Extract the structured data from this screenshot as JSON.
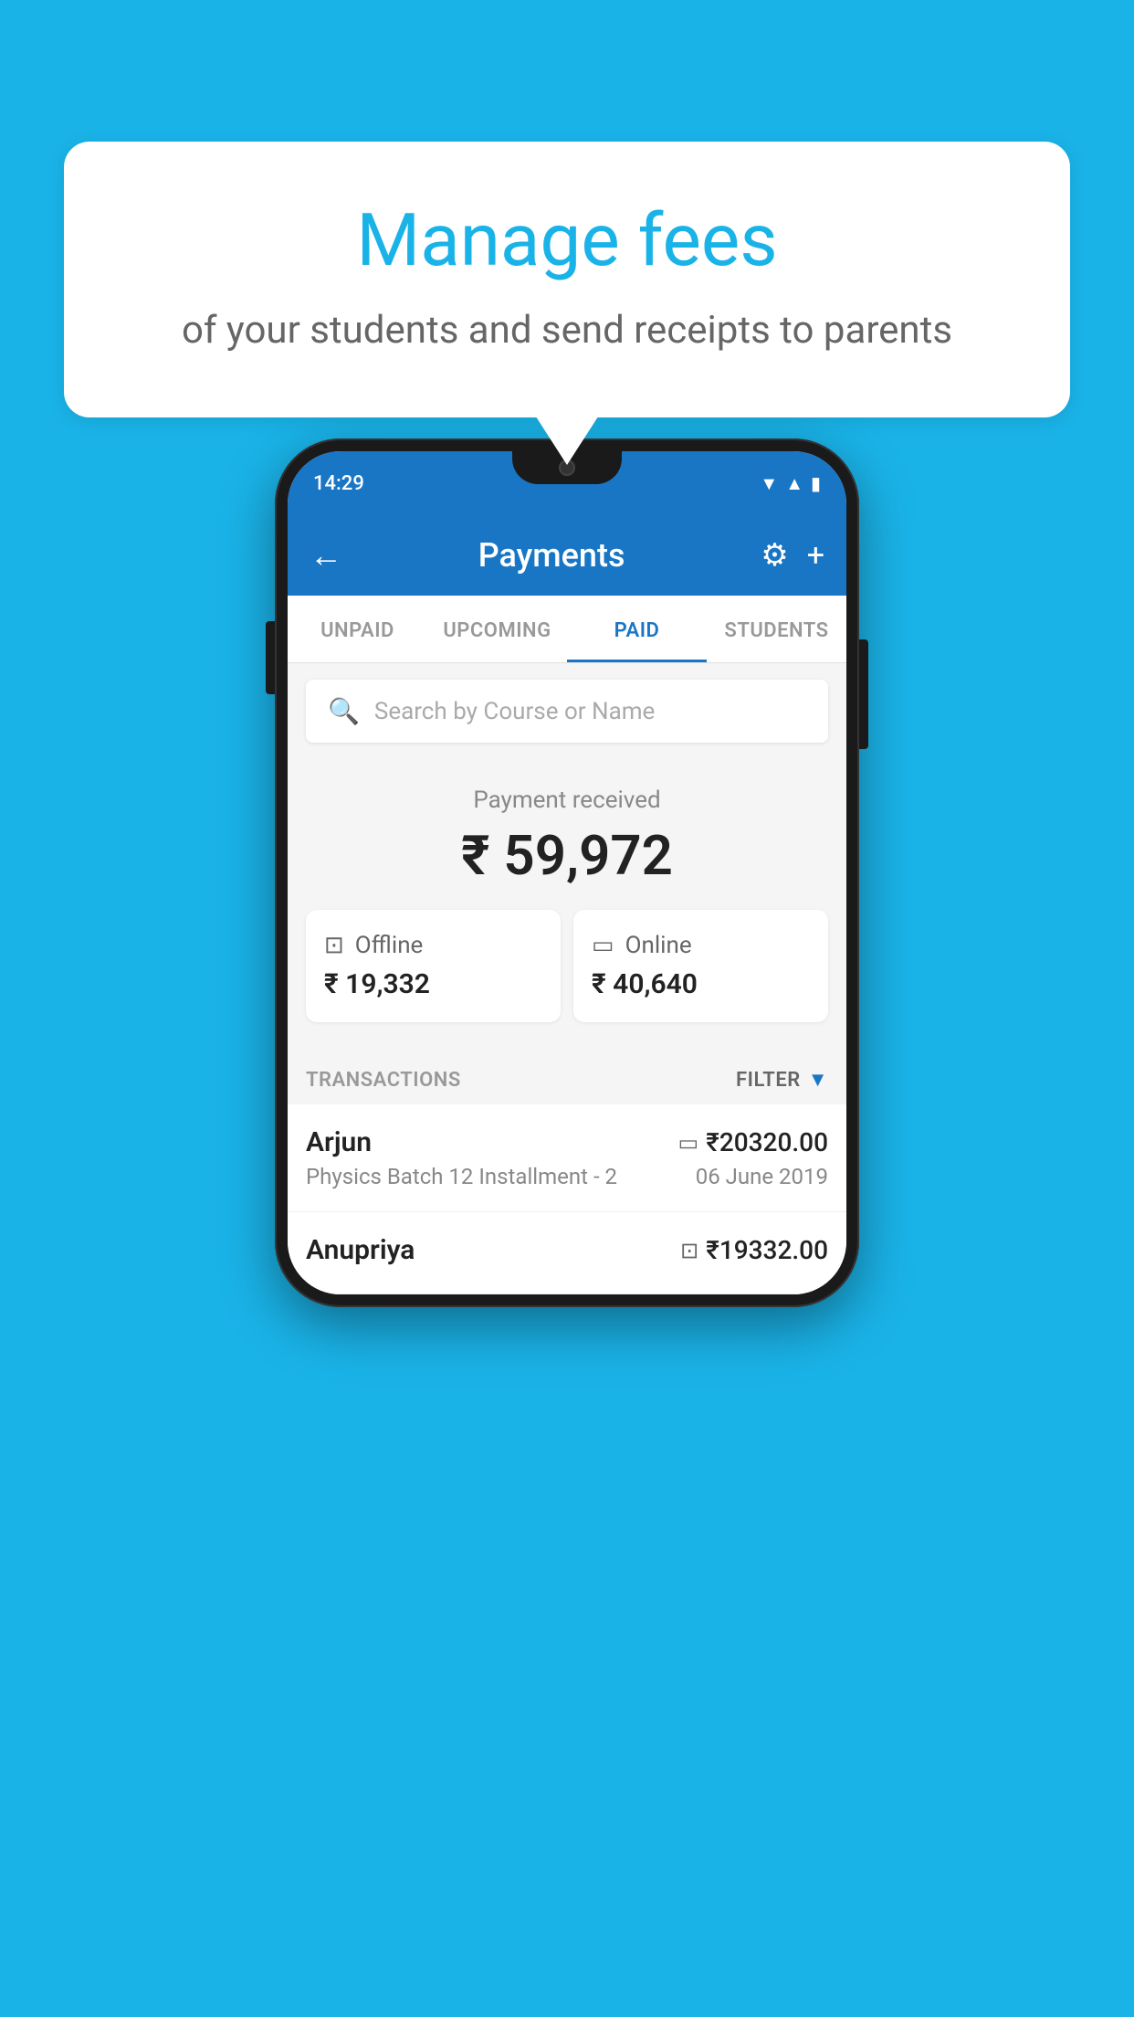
{
  "background_color": "#1ab3e8",
  "speech_bubble": {
    "title": "Manage fees",
    "subtitle": "of your students and send receipts to parents"
  },
  "phone": {
    "status_bar": {
      "time": "14:29"
    },
    "app_bar": {
      "title": "Payments",
      "back_label": "←",
      "gear_label": "⚙",
      "plus_label": "+"
    },
    "tabs": [
      {
        "label": "UNPAID",
        "active": false
      },
      {
        "label": "UPCOMING",
        "active": false
      },
      {
        "label": "PAID",
        "active": true
      },
      {
        "label": "STUDENTS",
        "active": false
      }
    ],
    "search": {
      "placeholder": "Search by Course or Name"
    },
    "payment_received": {
      "label": "Payment received",
      "amount": "₹ 59,972",
      "offline": {
        "label": "Offline",
        "amount": "₹ 19,332"
      },
      "online": {
        "label": "Online",
        "amount": "₹ 40,640"
      }
    },
    "transactions": {
      "header_label": "TRANSACTIONS",
      "filter_label": "FILTER",
      "rows": [
        {
          "name": "Arjun",
          "description": "Physics Batch 12 Installment - 2",
          "amount": "₹20320.00",
          "date": "06 June 2019",
          "payment_type": "online"
        },
        {
          "name": "Anupriya",
          "description": "",
          "amount": "₹19332.00",
          "date": "",
          "payment_type": "offline"
        }
      ]
    }
  }
}
